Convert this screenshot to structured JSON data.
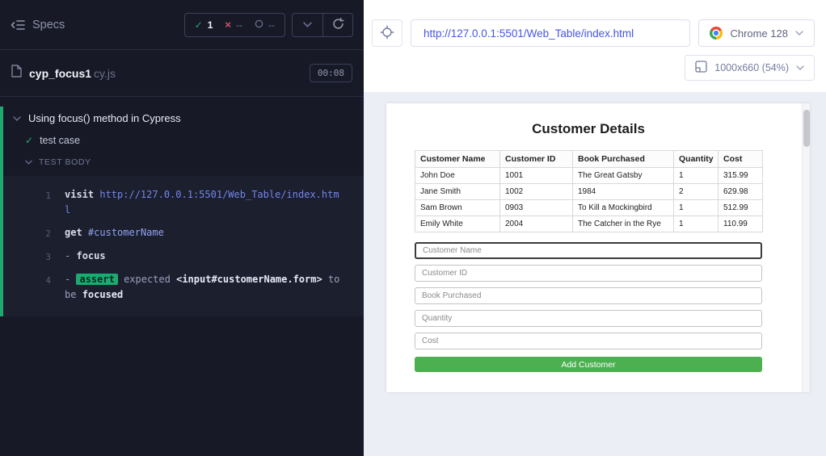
{
  "colors": {
    "pass_green": "#1fa971",
    "fail_red": "#d8556a",
    "url_blue": "#4556e4",
    "add_button_green": "#4caf50"
  },
  "reporter": {
    "specs_label": "Specs",
    "stats": {
      "passed": "1",
      "failed": "--",
      "pending": "--"
    },
    "spec": {
      "name": "cyp_focus1",
      "ext": "cy.js",
      "time": "00:08"
    },
    "suite_title": "Using focus() method in Cypress",
    "test_title": "test case",
    "test_body_label": "TEST BODY",
    "commands": [
      {
        "num": "1",
        "segments": [
          {
            "t": "visit",
            "c": "name"
          },
          {
            "t": "http://127.0.0.1:5501/Web_Table/index.html",
            "c": "url"
          }
        ]
      },
      {
        "num": "2",
        "segments": [
          {
            "t": "get",
            "c": "name"
          },
          {
            "t": "#customerName",
            "c": "selector"
          }
        ]
      },
      {
        "num": "3",
        "segments": [
          {
            "t": "-",
            "c": "dash"
          },
          {
            "t": "focus",
            "c": "name"
          }
        ]
      },
      {
        "num": "4",
        "segments": [
          {
            "t": "-",
            "c": "dash"
          },
          {
            "t": "assert",
            "c": "assert"
          },
          {
            "t": "expected",
            "c": "muted"
          },
          {
            "t": "<input#customerName.form>",
            "c": "strong"
          },
          {
            "t": "to",
            "c": "muted"
          },
          {
            "t": "be",
            "c": "muted"
          },
          {
            "t": "focused",
            "c": "strong"
          }
        ]
      }
    ]
  },
  "browser_bar": {
    "url": "http://127.0.0.1:5501/Web_Table/index.html",
    "browser_label": "Chrome 128",
    "viewport_label": "1000x660 (54%)"
  },
  "aut": {
    "title": "Customer Details",
    "table": {
      "headers": [
        "Customer Name",
        "Customer ID",
        "Book Purchased",
        "Quantity",
        "Cost"
      ],
      "rows": [
        [
          "John Doe",
          "1001",
          "The Great Gatsby",
          "1",
          "315.99"
        ],
        [
          "Jane Smith",
          "1002",
          "1984",
          "2",
          "629.98"
        ],
        [
          "Sam Brown",
          "0903",
          "To Kill a Mockingbird",
          "1",
          "512.99"
        ],
        [
          "Emily White",
          "2004",
          "The Catcher in the Rye",
          "1",
          "110.99"
        ]
      ]
    },
    "inputs": [
      {
        "placeholder": "Customer Name",
        "focused": true
      },
      {
        "placeholder": "Customer ID",
        "focused": false
      },
      {
        "placeholder": "Book Purchased",
        "focused": false
      },
      {
        "placeholder": "Quantity",
        "focused": false
      },
      {
        "placeholder": "Cost",
        "focused": false
      }
    ],
    "add_button_label": "Add Customer"
  }
}
